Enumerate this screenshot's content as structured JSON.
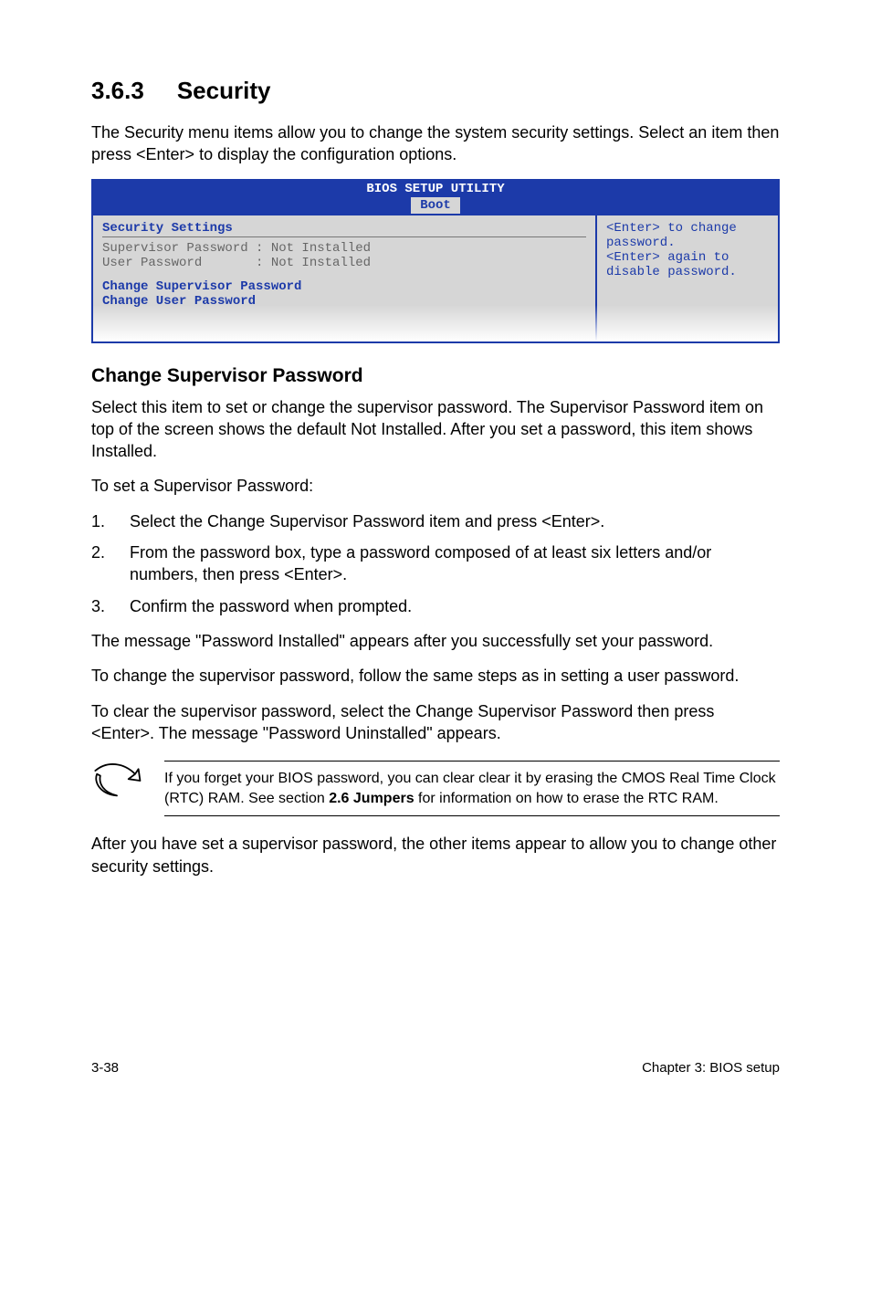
{
  "heading": {
    "number": "3.6.3",
    "title": "Security"
  },
  "intro": "The Security menu items allow you to change the system security settings. Select an item then press <Enter> to display the configuration options.",
  "bios": {
    "header": "BIOS SETUP UTILITY",
    "tab": "Boot",
    "left": {
      "section_title": "Security Settings",
      "row1": "Supervisor Password : Not Installed",
      "row2": "User Password       : Not Installed",
      "link1": "Change Supervisor Password",
      "link2": "Change User Password"
    },
    "right": {
      "l1": "<Enter> to change",
      "l2": "password.",
      "l3": "<Enter> again to",
      "l4": "disable password."
    }
  },
  "sub_heading": "Change Supervisor Password",
  "para1": "Select this item to set or change the supervisor password. The Supervisor Password item on top of the screen shows the default Not Installed. After you set a password, this item shows Installed.",
  "para2": "To set a Supervisor Password:",
  "steps": {
    "s1n": "1.",
    "s1": "Select the Change Supervisor Password item and press <Enter>.",
    "s2n": "2.",
    "s2": "From the password box, type a password composed of at least six letters and/or numbers, then press <Enter>.",
    "s3n": "3.",
    "s3": "Confirm the password when prompted."
  },
  "para3": "The message \"Password Installed\" appears after you successfully set your password.",
  "para4": "To change the supervisor password, follow the same steps as in setting a user password.",
  "para5": "To clear the supervisor password, select the Change Supervisor Password then press <Enter>. The message \"Password Uninstalled\" appears.",
  "note": {
    "pre": "If you forget your BIOS password, you can clear clear it by erasing the CMOS Real Time Clock (RTC) RAM. See section ",
    "bold": "2.6 Jumpers",
    "post": " for information on how to erase the RTC RAM."
  },
  "para6": "After you have set a supervisor password, the other items appear to allow you to change other security settings.",
  "footer": {
    "left": "3-38",
    "right": "Chapter 3: BIOS setup"
  }
}
